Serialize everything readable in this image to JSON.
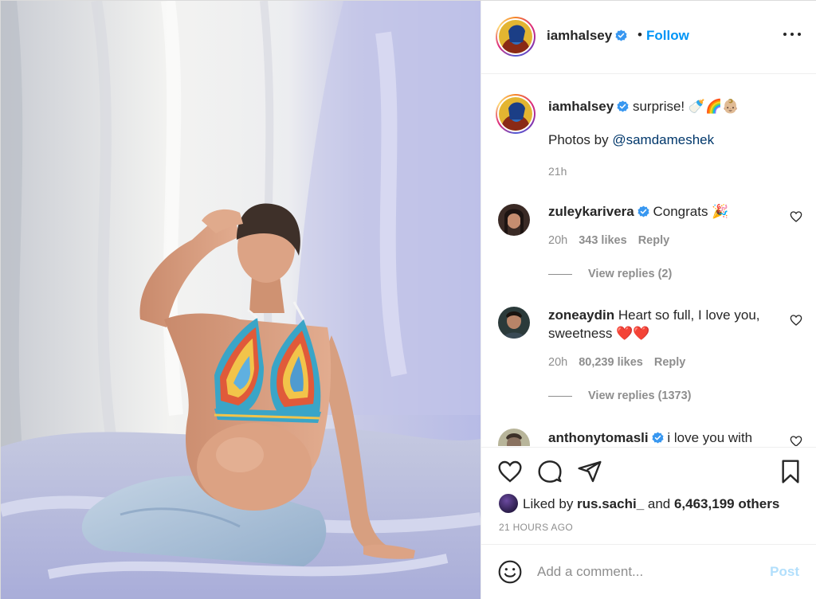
{
  "post": {
    "author": "iamhalsey",
    "follow_label": "Follow",
    "separator": "•",
    "caption_text": "surprise! 🍼🌈👶🏼",
    "caption_photos_prefix": "Photos by ",
    "caption_mention": "@samdameshek",
    "caption_time": "21h",
    "liked_by_prefix": "Liked by ",
    "liked_by_user": "rus.sachi_",
    "liked_by_mid": " and ",
    "likes_count": "6,463,199 others",
    "posted_ago": "21 HOURS AGO"
  },
  "comments": [
    {
      "user": "zuleykarivera",
      "verified": true,
      "text": "Congrats 🎉",
      "time": "20h",
      "likes": "343 likes",
      "reply_label": "Reply",
      "view_replies": "View replies (2)"
    },
    {
      "user": "zoneaydin",
      "verified": false,
      "text": "Heart so full, I love you, sweetness ❤️❤️",
      "time": "20h",
      "likes": "80,239 likes",
      "reply_label": "Reply",
      "view_replies": "View replies (1373)"
    },
    {
      "user": "anthonytomasli",
      "verified": true,
      "text": "i love you with"
    }
  ],
  "composer": {
    "placeholder": "Add a comment...",
    "post_label": "Post"
  },
  "icons": [
    "more-options-icon",
    "verified-badge-icon",
    "heart-icon",
    "comment-icon",
    "share-icon",
    "bookmark-icon",
    "emoji-icon"
  ],
  "colors": {
    "follow_blue": "#0095f6",
    "verified_blue": "#3897f0",
    "mention": "#00376b",
    "post_disabled": "#b2dffc"
  }
}
